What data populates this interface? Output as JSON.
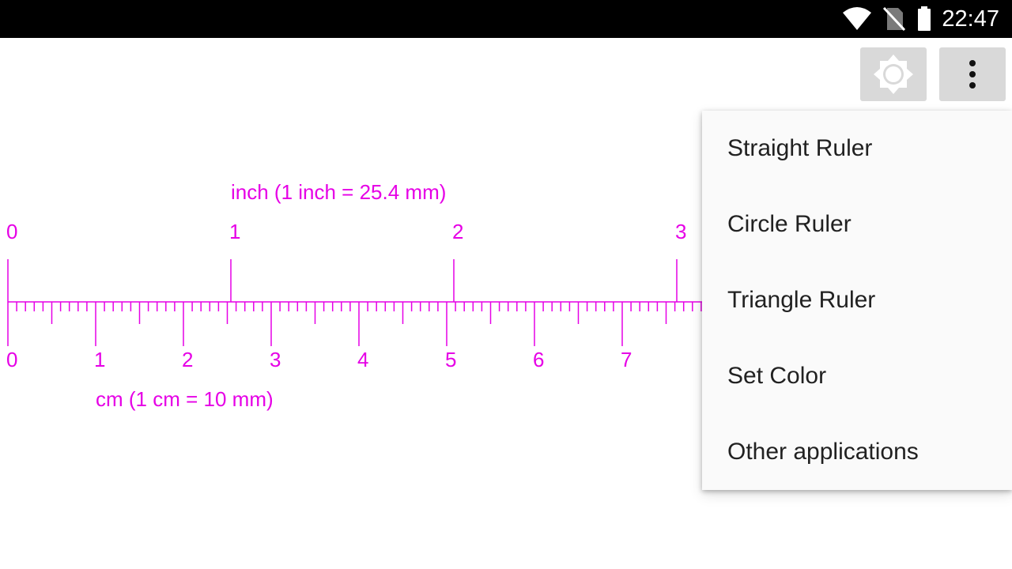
{
  "status_bar": {
    "time": "22:47",
    "icons": [
      "wifi-icon",
      "no-sim-icon",
      "battery-icon"
    ]
  },
  "toolbar": {
    "brightness_icon": "brightness-icon",
    "overflow_icon": "more-vert-icon",
    "button_color": "#d9d9d9"
  },
  "ruler": {
    "color": "#e600e6",
    "inch_label": "inch (1 inch = 25.4 mm)",
    "cm_label": "cm (1 cm = 10 mm)",
    "inch_ticks": [
      "0",
      "1",
      "2",
      "3"
    ],
    "cm_ticks": [
      "0",
      "1",
      "2",
      "3",
      "4",
      "5",
      "6",
      "7"
    ]
  },
  "menu": {
    "items": [
      {
        "label": "Straight Ruler"
      },
      {
        "label": "Circle Ruler"
      },
      {
        "label": "Triangle Ruler"
      },
      {
        "label": "Set Color"
      },
      {
        "label": "Other applications"
      }
    ]
  }
}
